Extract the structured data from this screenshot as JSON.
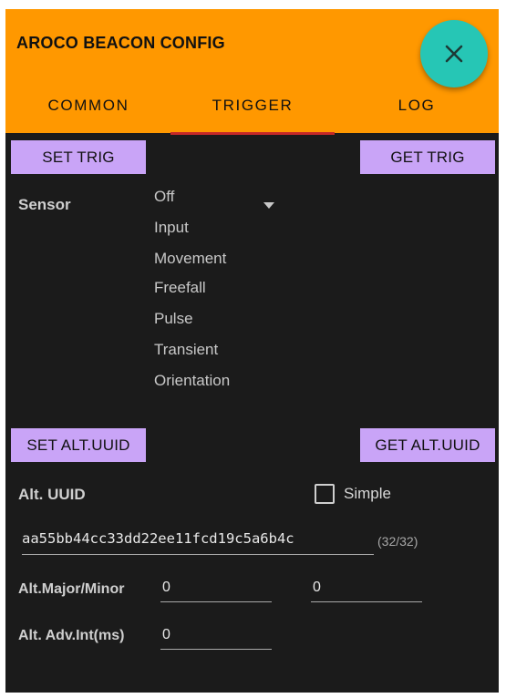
{
  "app": {
    "title": "AROCO BEACON CONFIG"
  },
  "fab": {
    "icon": "close-icon"
  },
  "tabs": [
    {
      "label": "COMMON",
      "active": false
    },
    {
      "label": "TRIGGER",
      "active": true
    },
    {
      "label": "LOG",
      "active": false
    }
  ],
  "trigger": {
    "set_button": "SET TRIG",
    "get_button": "GET TRIG",
    "sensor_label": "Sensor",
    "sensor_options": [
      "Off",
      "Input",
      "Movement",
      "Freefall",
      "Pulse",
      "Transient",
      "Orientation"
    ],
    "set_alt_uuid_button": "SET ALT.UUID",
    "get_alt_uuid_button": "GET ALT.UUID",
    "alt_uuid_label": "Alt. UUID",
    "simple_label": "Simple",
    "simple_checked": false,
    "alt_uuid_value": "aa55bb44cc33dd22ee11fcd19c5a6b4c",
    "alt_uuid_counter": "(32/32)",
    "major_minor_label": "Alt.Major/Minor",
    "major_value": "0",
    "minor_value": "0",
    "adv_int_label": "Alt. Adv.Int(ms)",
    "adv_int_value": "0"
  },
  "colors": {
    "header": "#ff9800",
    "background": "#1b1b1b",
    "button": "#c9a4f7",
    "fab": "#26c6b5",
    "tab_indicator": "#c62828"
  }
}
